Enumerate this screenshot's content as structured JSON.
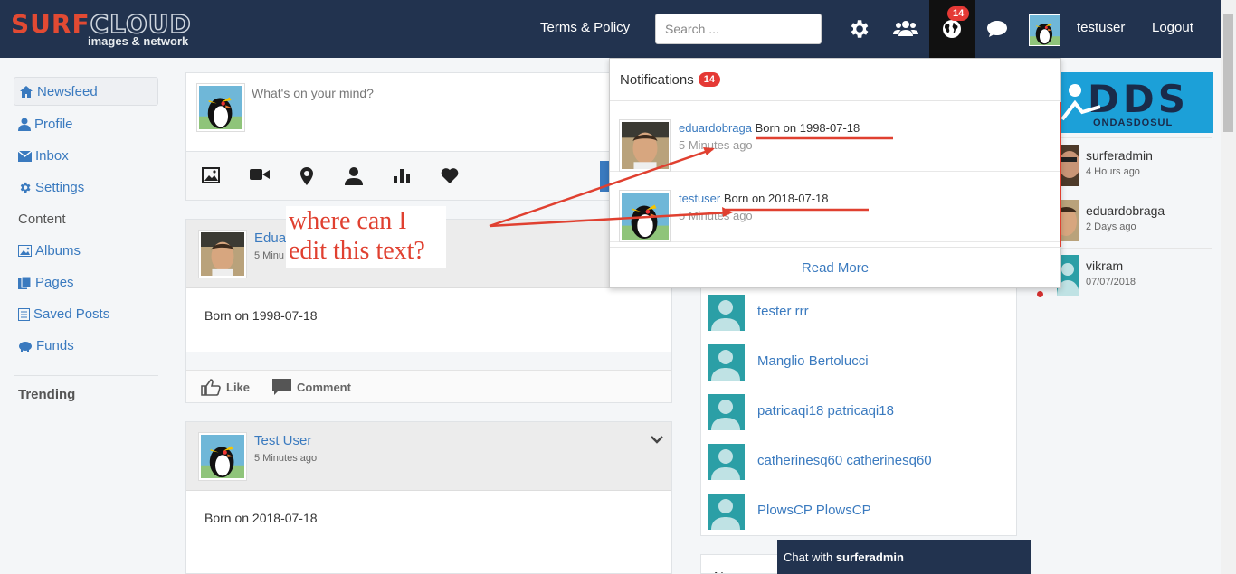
{
  "logo": {
    "part1": "SURF",
    "part2": "CLOUD",
    "tagline": "images & network"
  },
  "header": {
    "terms": "Terms & Policy",
    "search_placeholder": "Search ...",
    "notification_count": "14",
    "username": "testuser",
    "logout": "Logout",
    "icons": [
      "gear-icon",
      "users-icon",
      "globe-icon",
      "chat-bubble-icon"
    ]
  },
  "sidebar": {
    "items": [
      {
        "label": "Newsfeed",
        "icon": "home-icon",
        "active": true
      },
      {
        "label": "Profile",
        "icon": "user-icon"
      },
      {
        "label": "Inbox",
        "icon": "envelope-icon"
      },
      {
        "label": "Settings",
        "icon": "gear-icon"
      }
    ],
    "content_heading": "Content",
    "content_items": [
      {
        "label": "Albums",
        "icon": "image-icon"
      },
      {
        "label": "Pages",
        "icon": "pages-icon"
      },
      {
        "label": "Saved Posts",
        "icon": "list-icon"
      },
      {
        "label": "Funds",
        "icon": "piggy-bank-icon"
      }
    ],
    "trending_heading": "Trending"
  },
  "composer": {
    "placeholder": "What's on your mind?",
    "tools": [
      "image-icon",
      "video-icon",
      "location-icon",
      "person-icon",
      "bar-chart-icon",
      "heart-icon"
    ]
  },
  "posts": [
    {
      "name": "Eduar",
      "time": "5 Minu",
      "body": "Born on 1998-07-18",
      "like": "Like",
      "comment": "Comment"
    },
    {
      "name": "Test User",
      "time": "5 Minutes ago",
      "body": "Born on 2018-07-18"
    }
  ],
  "annotation": {
    "line1": "where can I",
    "line2": "edit this text?",
    "color": "#e04030"
  },
  "notifications": {
    "title": "Notifications",
    "count": "14",
    "items": [
      {
        "user": "eduardobraga",
        "text": "Born on 1998-07-18",
        "time": "5 Minutes ago"
      },
      {
        "user": "testuser",
        "text": "Born on 2018-07-18",
        "time": "5 Minutes ago"
      }
    ],
    "read_more": "Read More"
  },
  "friends": [
    "tester rrr",
    "Manglio Bertolucci",
    "patricaqi18 patricaqi18",
    "catherinesq60 catherinesq60",
    "PlowsCP PlowsCP"
  ],
  "right_panel": {
    "banner_text": "ONDASDOSUL",
    "users": [
      {
        "name": "surferadmin",
        "time": "4 Hours ago"
      },
      {
        "name": "eduardobraga",
        "time": "2 Days ago"
      },
      {
        "name": "vikram",
        "time": "07/07/2018"
      }
    ]
  },
  "chat": {
    "prefix": "Chat with",
    "user": "surferadmin"
  },
  "peek_text": "N",
  "colors": {
    "navbar": "#22334f",
    "link": "#3a7abf",
    "badge": "#e53935",
    "annotation": "#e04030"
  }
}
